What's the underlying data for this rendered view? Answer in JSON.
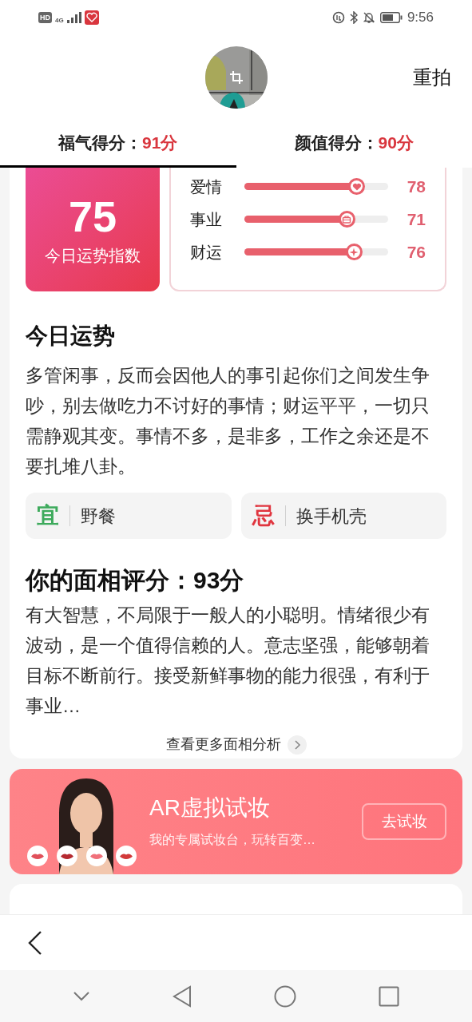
{
  "status_bar": {
    "hd": "HD",
    "network": "4G",
    "time": "9:56"
  },
  "header": {
    "retake": "重拍"
  },
  "tabs": [
    {
      "label": "福气得分：",
      "score": "91分",
      "selected": true
    },
    {
      "label": "颜值得分：",
      "score": "90分",
      "selected": false
    }
  ],
  "fortune_index": {
    "value": "75",
    "label": "今日运势指数"
  },
  "fortune_bars": [
    {
      "name": "爱情",
      "kind": "heart",
      "level": 0.78,
      "reading": "78"
    },
    {
      "name": "事业",
      "kind": "briefcase",
      "level": 0.71,
      "reading": "71"
    },
    {
      "name": "财运",
      "kind": "sparkle",
      "level": 0.76,
      "reading": "76"
    }
  ],
  "today": {
    "title": "今日运势",
    "text": "多管闲事，反而会因他人的事引起你们之间发生争吵，别去做吃力不讨好的事情；财运平平，一切只需静观其变。事情不多，是非多，工作之余还是不要扎堆八卦。"
  },
  "advice": [
    {
      "kind": "good",
      "mark": "宜",
      "text": "野餐"
    },
    {
      "kind": "bad",
      "mark": "忌",
      "text": "换手机壳"
    }
  ],
  "face": {
    "title": "你的面相评分：93分",
    "text": "有大智慧，不局限于一般人的小聪明。情绪很少有波动，是一个值得信赖的人。意志坚强，能够朝着目标不断前行。接受新鲜事物的能力很强，有利于事业…",
    "more": "查看更多面相分析"
  },
  "ar_banner": {
    "title": "AR虚拟试妆",
    "subtitle": "我的专属试妆台，玩转百变…",
    "button": "去试妆"
  }
}
